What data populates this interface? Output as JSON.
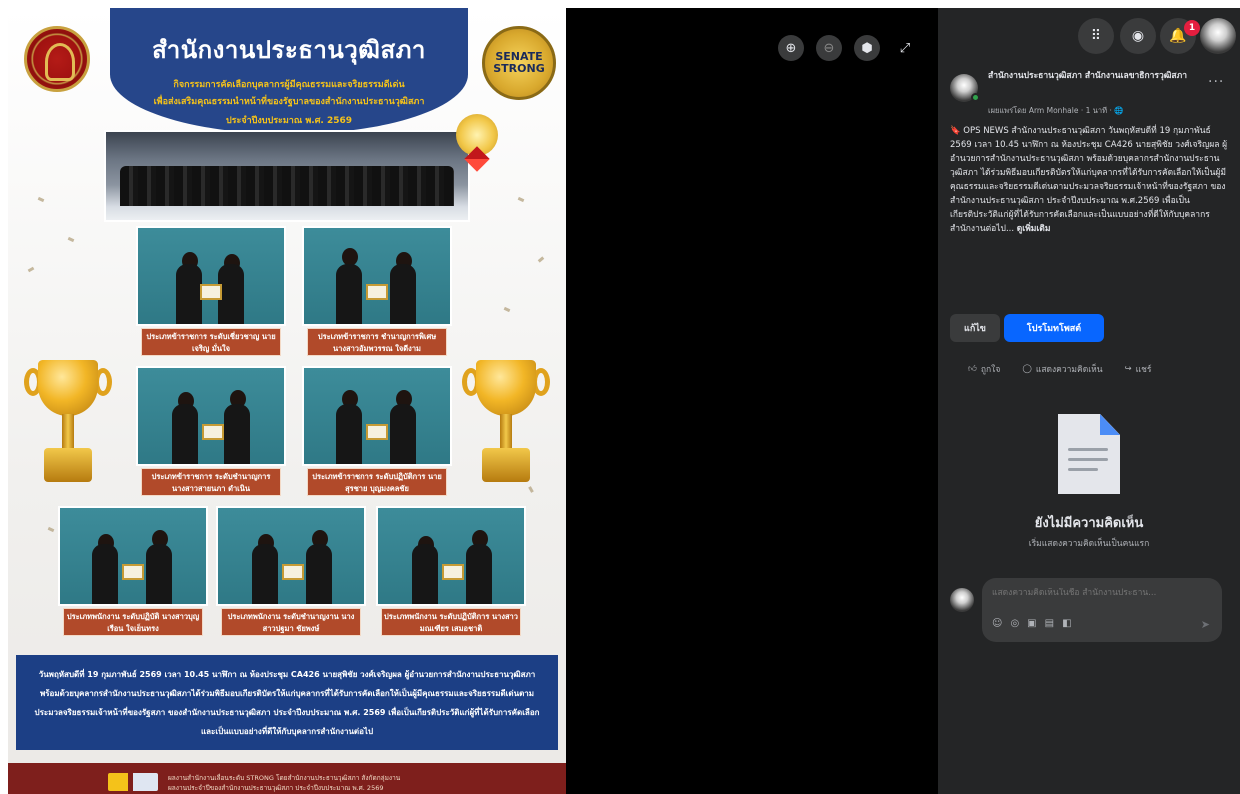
{
  "poster": {
    "title": "สำนักงานประธานวุฒิสภา",
    "subtitle_1": "กิจกรรมการคัดเลือกบุคลากรผู้มีคุณธรรมและจริยธรรมดีเด่น",
    "subtitle_2": "เพื่อส่งเสริมคุณธรรมนำหน้าที่ของรัฐบาลของสำนักงานประธานวุฒิสภา",
    "subtitle_3": "ประจำปีงบประมาณ พ.ศ. 2569",
    "badge_right": "SENATE STRONG",
    "captions": [
      "ประเภทข้าราชการ ระดับเชี่ยวชาญ นายเจริญ มั่นใจ",
      "ประเภทข้าราชการ ชำนาญการพิเศษ นางสาวอัมพวรรณ ใจดีงาม",
      "ประเภทข้าราชการ ระดับชำนาญการ นางสาวสายนภา ดำเนิน",
      "ประเภทข้าราชการ ระดับปฏิบัติการ นายสุรชาย บุญมงคลชัย",
      "ประเภทพนักงาน ระดับปฏิบัติ นางสาวบุญเรือน ใจเย็นทรง",
      "ประเภทพนักงาน ระดับชำนาญงาน นางสาวปฐมา ชัยพงษ์",
      "ประเภทพนักงาน ระดับปฏิบัติการ นางสาวมณเฑียร เสมอชาติ"
    ],
    "body_text": "วันพฤหัสบดีที่ 19 กุมภาพันธ์ 2569 เวลา 10.45 นาฬิกา ณ ห้องประชุม CA426 นายสุพิชัย วงศ์เจริญผล ผู้อำนวยการสำนักงานประธานวุฒิสภา พร้อมด้วยบุคลากรสำนักงานประธานวุฒิสภาได้ร่วมพิธีมอบเกียรติบัตรให้แก่บุคลากรที่ได้รับการคัดเลือกให้เป็นผู้มีคุณธรรมและจริยธรรมดีเด่นตามประมวลจริยธรรมเจ้าหน้าที่ของรัฐสภา ของสำนักงานประธานวุฒิสภา ประจำปีงบประมาณ พ.ศ. 2569 เพื่อเป็นเกียรติประวัติแก่ผู้ที่ได้รับการคัดเลือกและเป็นแบบอย่างที่ดีให้กับบุคลากรสำนักงานต่อไป",
    "footer_line_1": "ผลงานสำนักงานเลื่อนระดับ STRONG โดยสำนักงานประธานวุฒิสภา สังกัดกลุ่มงาน",
    "footer_line_2": "ผลงานประจำปีของสำนักงานประธานวุฒิสภา ประจำปีงบประมาณ พ.ศ. 2569"
  },
  "viewer": {
    "zoom_in_icon": "zoom-in-icon",
    "zoom_out_icon": "zoom-out-icon",
    "tag_icon": "tag-icon",
    "fullscreen_icon": "fullscreen-icon"
  },
  "topbar": {
    "notification_count": "1"
  },
  "post": {
    "page_name": "สำนักงานประธานวุฒิสภา สำนักงานเลขาธิการวุฒิสภา",
    "meta": "เผยแพร่โดย Arm Monhale · 1 นาที · 🌐",
    "more": "···",
    "body": "🔖 OPS NEWS สำนักงานประธานวุฒิสภา วันพฤหัสบดีที่ 19 กุมภาพันธ์ 2569 เวลา 10.45 นาฬิกา ณ ห้องประชุม CA426 นายสุพิชัย วงศ์เจริญผล ผู้อำนวยการสำนักงานประธานวุฒิสภา พร้อมด้วยบุคลากรสำนักงานประธานวุฒิสภา ได้ร่วมพิธีมอบเกียรติบัตรให้แก่บุคลากรที่ได้รับการคัดเลือกให้เป็นผู้มีคุณธรรมและจริยธรรมดีเด่นตามประมวลจริยธรรมเจ้าหน้าที่ของรัฐสภา ของสำนักงานประธานวุฒิสภา ประจำปีงบประมาณ พ.ศ.2569 เพื่อเป็นเกียรติประวัติแก่ผู้ที่ได้รับการคัดเลือกและเป็นแบบอย่างที่ดีให้กับบุคลากรสำนักงานต่อไป...",
    "see_more": "ดูเพิ่มเติม",
    "edit_label": "แก้ไข",
    "promote_label": "โปรโมทโพสต์",
    "like_label": "ถูกใจ",
    "comment_label": "แสดงความคิดเห็น",
    "share_label": "แชร์"
  },
  "comments": {
    "empty_title": "ยังไม่มีความคิดเห็น",
    "empty_sub": "เริ่มแสดงความคิดเห็นเป็นคนแรก",
    "input_placeholder": "แสดงความคิดเห็นในชื่อ สำนักงานประธาน..."
  },
  "colors": {
    "panel_bg": "#242526",
    "accent_blue": "#0866ff",
    "poster_navy": "#26468a",
    "caption_rust": "#b14a2a",
    "notification_red": "#e41e3f"
  }
}
